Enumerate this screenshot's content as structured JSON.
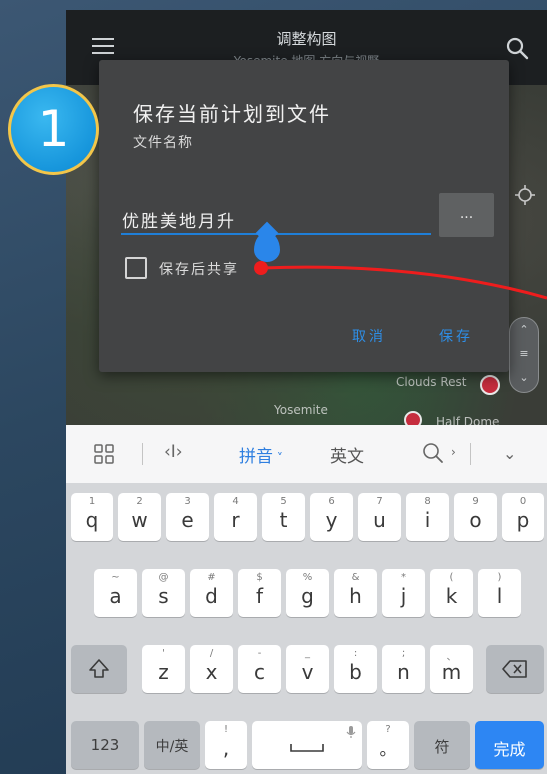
{
  "app": {
    "title": "调整构图",
    "subtitle": "Yosemite 地图·方向与视野",
    "icons": [
      "menu-icon",
      "search-icon"
    ]
  },
  "map": {
    "labels": [
      {
        "text": "Yosemite"
      },
      {
        "text": "Clouds Rest"
      },
      {
        "text": "Half Dome"
      }
    ]
  },
  "dialog": {
    "title": "保存当前计划到文件",
    "name_label": "文件名称",
    "file_name": "优胜美地月升",
    "more_label": "...",
    "share_checkbox_label": "保存后共享",
    "share_checked": false,
    "cancel_label": "取消",
    "save_label": "保存",
    "accent_color": "#2e8ee6"
  },
  "keyboard": {
    "toolbar": {
      "pinyin_label": "拼音",
      "english_label": "英文"
    },
    "row1": [
      {
        "hint": "1",
        "key": "q"
      },
      {
        "hint": "2",
        "key": "w"
      },
      {
        "hint": "3",
        "key": "e"
      },
      {
        "hint": "4",
        "key": "r"
      },
      {
        "hint": "5",
        "key": "t"
      },
      {
        "hint": "6",
        "key": "y"
      },
      {
        "hint": "7",
        "key": "u"
      },
      {
        "hint": "8",
        "key": "i"
      },
      {
        "hint": "9",
        "key": "o"
      },
      {
        "hint": "0",
        "key": "p"
      }
    ],
    "row2": [
      {
        "hint": "~",
        "key": "a"
      },
      {
        "hint": "@",
        "key": "s"
      },
      {
        "hint": "#",
        "key": "d"
      },
      {
        "hint": "$",
        "key": "f"
      },
      {
        "hint": "%",
        "key": "g"
      },
      {
        "hint": "&",
        "key": "h"
      },
      {
        "hint": "*",
        "key": "j"
      },
      {
        "hint": "(",
        "key": "k"
      },
      {
        "hint": ")",
        "key": "l"
      }
    ],
    "row3": [
      {
        "hint": "'",
        "key": "z"
      },
      {
        "hint": "/",
        "key": "x"
      },
      {
        "hint": "-",
        "key": "c"
      },
      {
        "hint": "_",
        "key": "v"
      },
      {
        "hint": ":",
        "key": "b"
      },
      {
        "hint": ";",
        "key": "n"
      },
      {
        "hint": "、",
        "key": "m"
      }
    ],
    "bottom": {
      "num_label": "123",
      "lang_label": "中/英",
      "comma_hint": "!",
      "comma_key": ",",
      "period_hint": "?",
      "period_key": "。",
      "symbol_label": "符",
      "done_label": "完成"
    }
  },
  "step_badge": "1",
  "colors": {
    "annotation": "#ee1d1d",
    "badge": "#1796dc",
    "badge_border": "#f2c64a",
    "done_key": "#2d86f3"
  }
}
